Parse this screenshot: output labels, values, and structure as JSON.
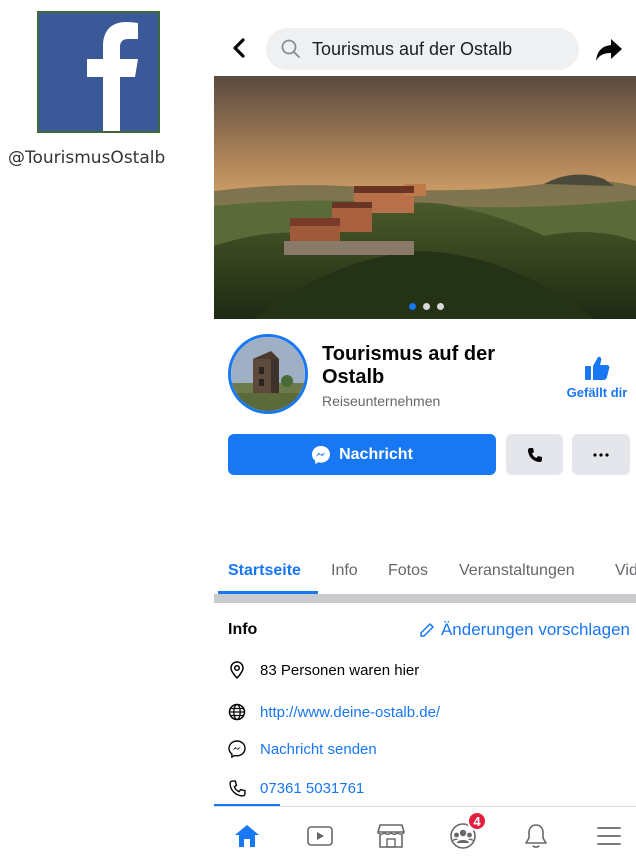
{
  "branding": {
    "logo_letter": "f",
    "handle": "@TourismusOstalb"
  },
  "topbar": {
    "search_text": "Tourismus auf der Ostalb"
  },
  "cover": {
    "carousel_total": 3,
    "carousel_active": 1
  },
  "page": {
    "name": "Tourismus auf der Ostalb",
    "category": "Reiseunternehmen",
    "like_label": "Gefällt dir"
  },
  "actions": {
    "message_label": "Nachricht"
  },
  "tabs": [
    {
      "label": "Startseite"
    },
    {
      "label": "Info"
    },
    {
      "label": "Fotos"
    },
    {
      "label": "Veranstaltungen"
    },
    {
      "label": "Vid"
    }
  ],
  "info": {
    "title": "Info",
    "suggest_label": "Änderungen vorschlagen",
    "items": [
      {
        "icon": "location-pin-icon",
        "text": "83 Personen waren hier",
        "link": false
      },
      {
        "icon": "globe-icon",
        "text": "http://www.deine-ostalb.de/",
        "link": true
      },
      {
        "icon": "messenger-icon",
        "text": "Nachricht senden",
        "link": true
      },
      {
        "icon": "phone-icon",
        "text": "07361 5031761",
        "link": true
      }
    ]
  },
  "bottom_nav": {
    "groups_badge": "4",
    "items": [
      "home-icon",
      "watch-icon",
      "marketplace-icon",
      "groups-icon",
      "notifications-icon",
      "menu-icon"
    ]
  },
  "colors": {
    "facebook_blue": "#1877f2",
    "logo_bg": "#3b5998",
    "badge_red": "#e41e3f"
  }
}
